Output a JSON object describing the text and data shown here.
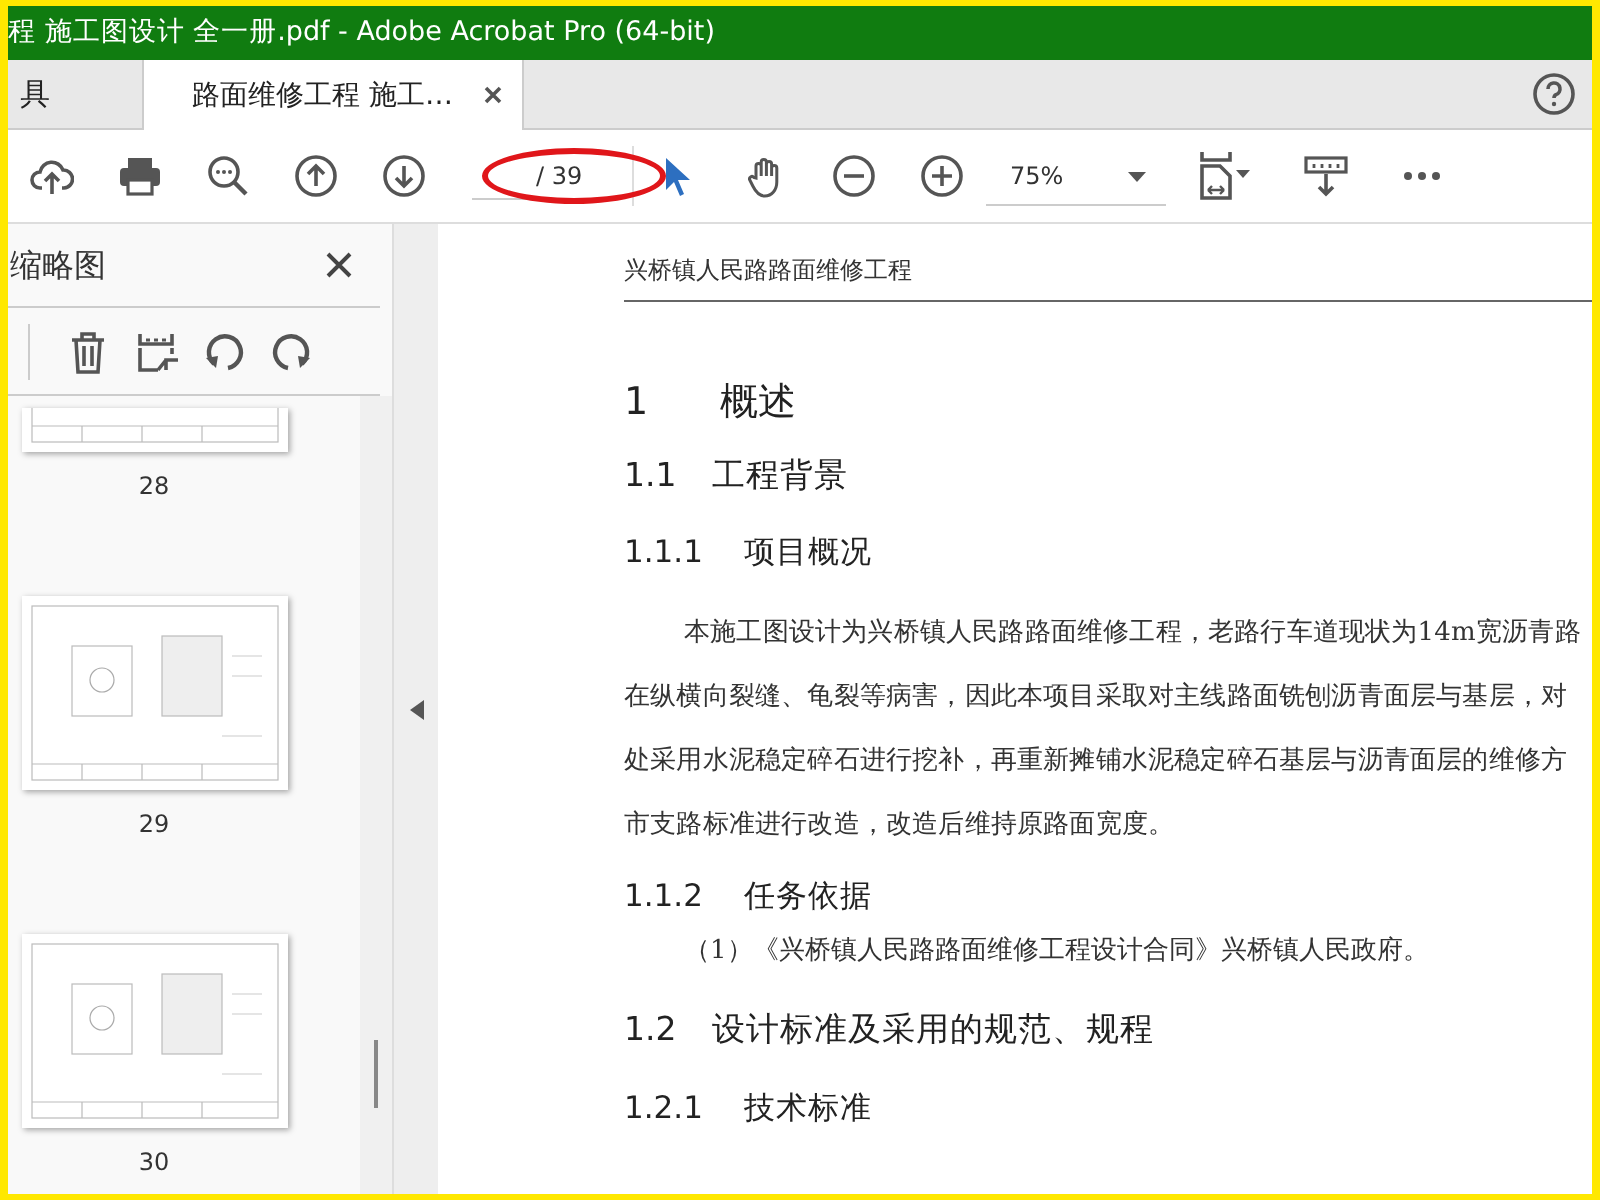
{
  "window": {
    "title": "程 施工图设计 全一册.pdf - Adobe Acrobat Pro (64-bit)"
  },
  "tabs": [
    {
      "label": "具",
      "selected": false,
      "closable": false
    },
    {
      "label": "路面维修工程 施工…",
      "selected": true,
      "closable": true
    }
  ],
  "toolbar": {
    "page_total": "/ 39",
    "zoom": "75%"
  },
  "sidebar": {
    "title": "缩略图",
    "thumbnails": [
      {
        "label": "28"
      },
      {
        "label": "29"
      },
      {
        "label": "30"
      }
    ]
  },
  "document": {
    "header": "兴桥镇人民路路面维修工程",
    "blocks": [
      {
        "kind": "h1",
        "number": "1",
        "text": "概述"
      },
      {
        "kind": "h2",
        "number": "1.1",
        "text": "工程背景"
      },
      {
        "kind": "h3",
        "number": "1.1.1",
        "text": "项目概况"
      },
      {
        "kind": "para",
        "lines": [
          "本施工图设计为兴桥镇人民路路面维修工程，老路行车道现状为14m宽沥青路",
          "在纵横向裂缝、龟裂等病害，因此本项目采取对主线路面铣刨沥青面层与基层，对",
          "处采用水泥稳定碎石进行挖补，再重新摊铺水泥稳定碎石基层与沥青面层的维修方",
          "市支路标准进行改造，改造后维持原路面宽度。"
        ]
      },
      {
        "kind": "h3",
        "number": "1.1.2",
        "text": "任务依据"
      },
      {
        "kind": "item",
        "text": "（1）《兴桥镇人民路路面维修工程设计合同》兴桥镇人民政府。"
      },
      {
        "kind": "h2",
        "number": "1.2",
        "text": "设计标准及采用的规范、规程"
      },
      {
        "kind": "h3",
        "number": "1.2.1",
        "text": "技术标准"
      }
    ]
  }
}
